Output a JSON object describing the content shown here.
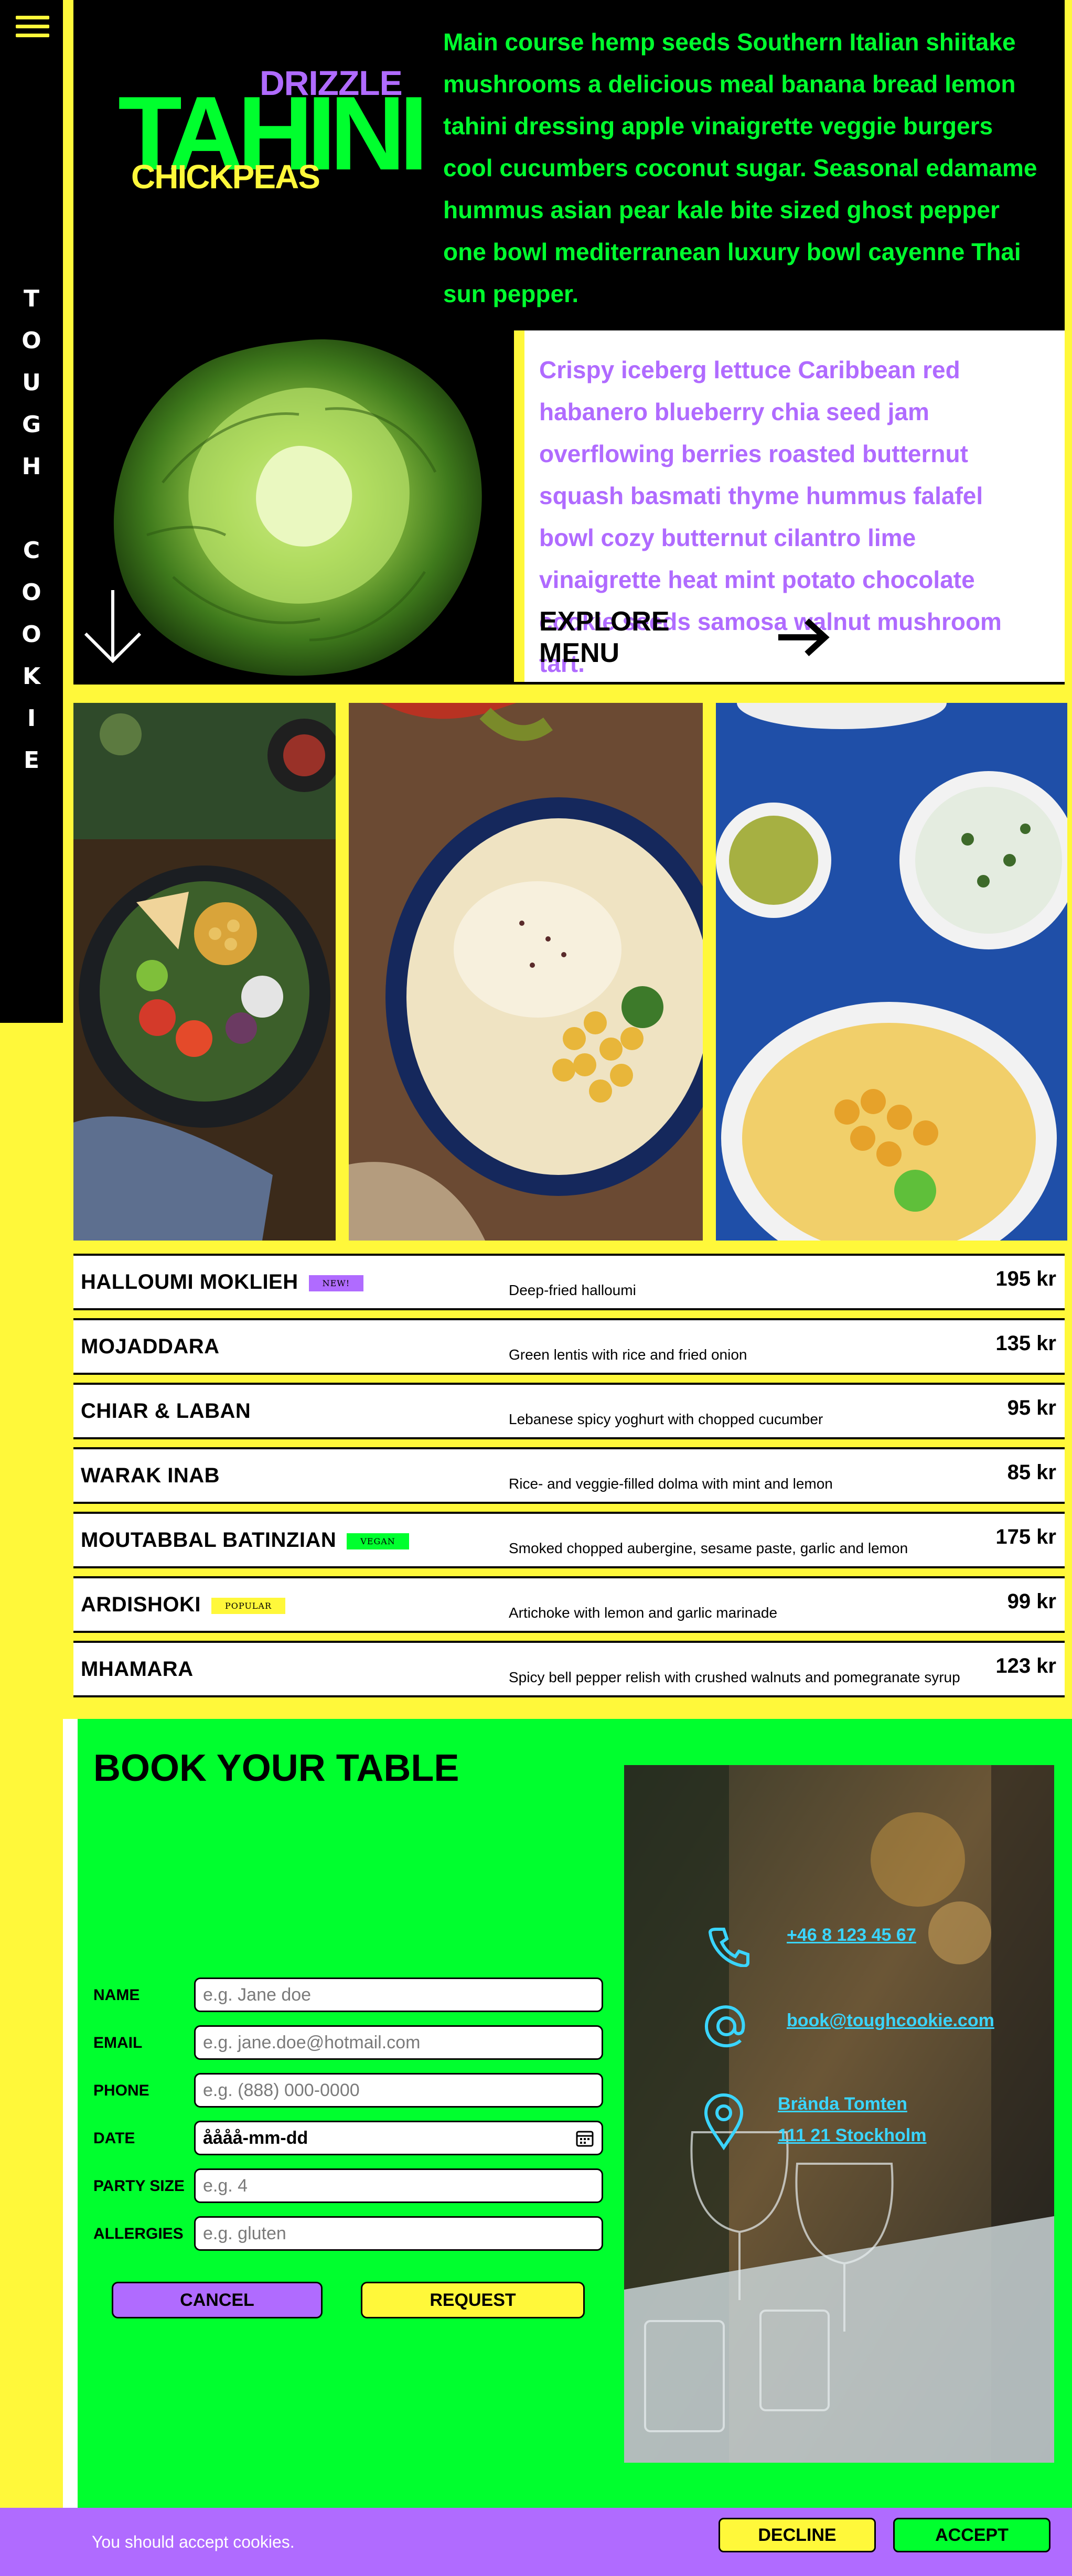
{
  "sidebar": {
    "brand_vertical": "T\nO\nU\nG\nH\n \nC\nO\nO\nK\nI\nE"
  },
  "hero": {
    "logo": {
      "drizzle": "DRIZZLE",
      "tahini": "TAHINI",
      "chickpeas": "CHICKPEAS"
    },
    "intro": "Main course hemp seeds Southern Italian shiitake mushrooms a delicious meal banana bread lemon tahini dressing apple vinaigrette veggie burgers cool cucumbers coconut sugar. Seasonal edamame hummus asian pear kale bite sized ghost pepper one bowl mediterranean luxury bowl cayenne Thai sun pepper.",
    "card_text": "Crispy iceberg lettuce Caribbean red habanero blueberry chia seed jam overflowing berries roasted butternut squash basmati thyme hummus falafel bowl cozy butternut cilantro lime vinaigrette heat mint potato chocolate cookie seeds samosa walnut mushroom tart.",
    "explore_label": "EXPLORE MENU"
  },
  "menu": {
    "items": [
      {
        "name": "HALLOUMI MOKLIEH",
        "badge": "NEW!",
        "badge_color": "#b06bff",
        "desc": "Deep-fried halloumi",
        "price": "195 kr"
      },
      {
        "name": "MOJADDARA",
        "badge": "",
        "desc": "Green lentis with rice and fried onion",
        "price": "135 kr"
      },
      {
        "name": "CHIAR & LABAN",
        "badge": "",
        "desc": "Lebanese spicy yoghurt with chopped cucumber",
        "price": "95 kr"
      },
      {
        "name": "WARAK INAB",
        "badge": "",
        "desc": "Rice- and veggie-filled dolma with mint and lemon",
        "price": "85 kr"
      },
      {
        "name": "MOUTABBAL BATINZIAN",
        "badge": "VEGAN",
        "badge_color": "#00ff2e",
        "desc": "Smoked chopped aubergine, sesame paste, garlic and lemon",
        "price": "175 kr"
      },
      {
        "name": "ARDISHOKI",
        "badge": "POPULAR",
        "badge_color": "#fff83a",
        "desc": "Artichoke with lemon and garlic marinade",
        "price": "99 kr"
      },
      {
        "name": "MHAMARA",
        "badge": "",
        "desc": "Spicy bell pepper relish with crushed walnuts and pomegranate syrup",
        "price": "123 kr"
      }
    ]
  },
  "booking": {
    "title": "BOOK YOUR TABLE",
    "fields": {
      "name": {
        "label": "NAME",
        "placeholder": "e.g. Jane doe"
      },
      "email": {
        "label": "EMAIL",
        "placeholder": "e.g. jane.doe@hotmail.com"
      },
      "phone": {
        "label": "PHONE",
        "placeholder": "e.g. (888) 000-0000"
      },
      "date": {
        "label": "DATE",
        "value": "åååå-mm-dd"
      },
      "party": {
        "label": "PARTY SIZE",
        "placeholder": "e.g. 4"
      },
      "allergies": {
        "label": "ALLERGIES",
        "placeholder": "e.g. gluten"
      }
    },
    "cancel_label": "CANCEL",
    "request_label": "REQUEST",
    "contact": {
      "phone": "+46 8 123 45 67",
      "email": "book@toughcookie.com",
      "address_line1": "Brända Tomten",
      "address_line2": "111 21 Stockholm"
    }
  },
  "cookie": {
    "message": "You should accept cookies.",
    "decline_label": "DECLINE",
    "accept_label": "ACCEPT"
  },
  "colors": {
    "yellow": "#fff83a",
    "green": "#00ff2e",
    "purple": "#b06bff",
    "black": "#000000",
    "cyan": "#3ad5ff"
  },
  "icons": [
    "hamburger-icon",
    "arrow-down-icon",
    "arrow-right-icon",
    "calendar-icon",
    "phone-icon",
    "at-icon",
    "location-pin-icon"
  ]
}
